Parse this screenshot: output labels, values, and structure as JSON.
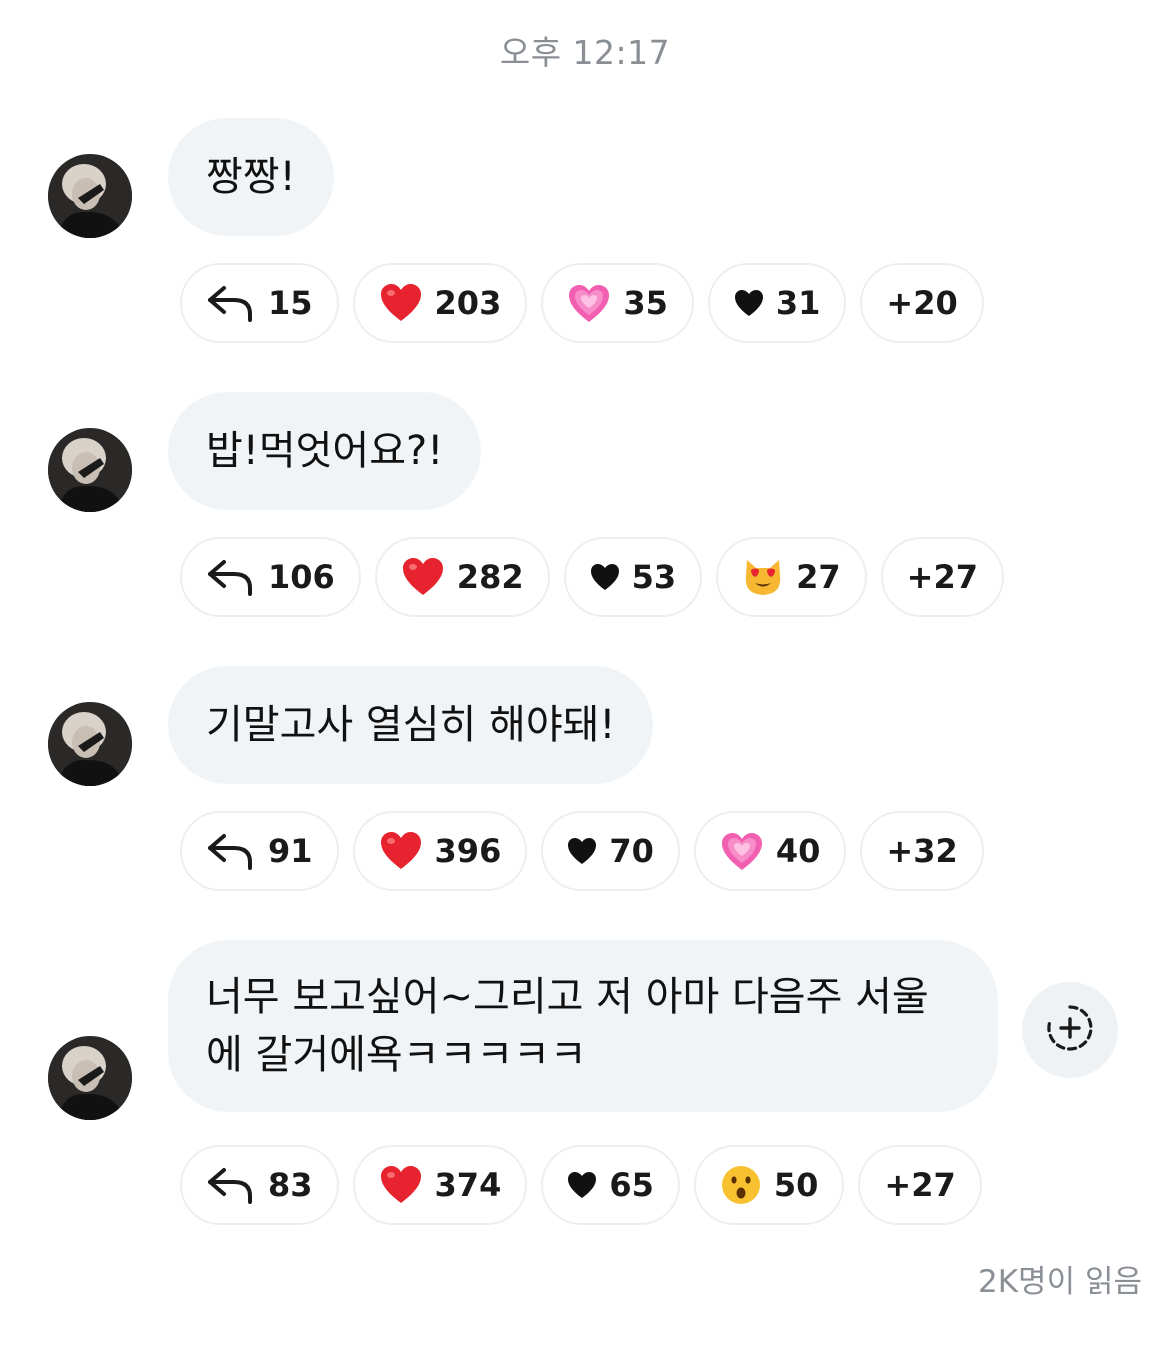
{
  "timestamp": "오후 12:17",
  "messages": [
    {
      "text": "짱짱!",
      "reactions": [
        {
          "icon": "reply-icon",
          "count": "15"
        },
        {
          "icon": "red-heart-icon",
          "count": "203"
        },
        {
          "icon": "sparkling-pink-heart-icon",
          "count": "35"
        },
        {
          "icon": "black-heart-icon",
          "count": "31"
        },
        {
          "icon": "",
          "count": "+20"
        }
      ]
    },
    {
      "text": "밥!먹엇어요?!",
      "reactions": [
        {
          "icon": "reply-icon",
          "count": "106"
        },
        {
          "icon": "red-heart-icon",
          "count": "282"
        },
        {
          "icon": "black-heart-icon",
          "count": "53"
        },
        {
          "icon": "heart-eyes-cat-icon",
          "count": "27"
        },
        {
          "icon": "",
          "count": "+27"
        }
      ]
    },
    {
      "text": "기말고사 열심히 해야돼!",
      "reactions": [
        {
          "icon": "reply-icon",
          "count": "91"
        },
        {
          "icon": "red-heart-icon",
          "count": "396"
        },
        {
          "icon": "black-heart-icon",
          "count": "70"
        },
        {
          "icon": "sparkling-pink-heart-icon",
          "count": "40"
        },
        {
          "icon": "",
          "count": "+32"
        }
      ]
    },
    {
      "text": "너무 보고싶어~그리고 저 아마 다음주 서울에 갈거에욕ㅋㅋㅋㅋㅋ",
      "reactions": [
        {
          "icon": "reply-icon",
          "count": "83"
        },
        {
          "icon": "red-heart-icon",
          "count": "374"
        },
        {
          "icon": "black-heart-icon",
          "count": "65"
        },
        {
          "icon": "surprised-face-icon",
          "count": "50"
        },
        {
          "icon": "",
          "count": "+27"
        }
      ]
    }
  ],
  "read_count": "2K명이 읽음",
  "colors": {
    "bubble": "#f1f4f6",
    "muted_text": "#8a8f96",
    "red_heart": "#e6232f",
    "pink_heart": "#f25fb0"
  }
}
